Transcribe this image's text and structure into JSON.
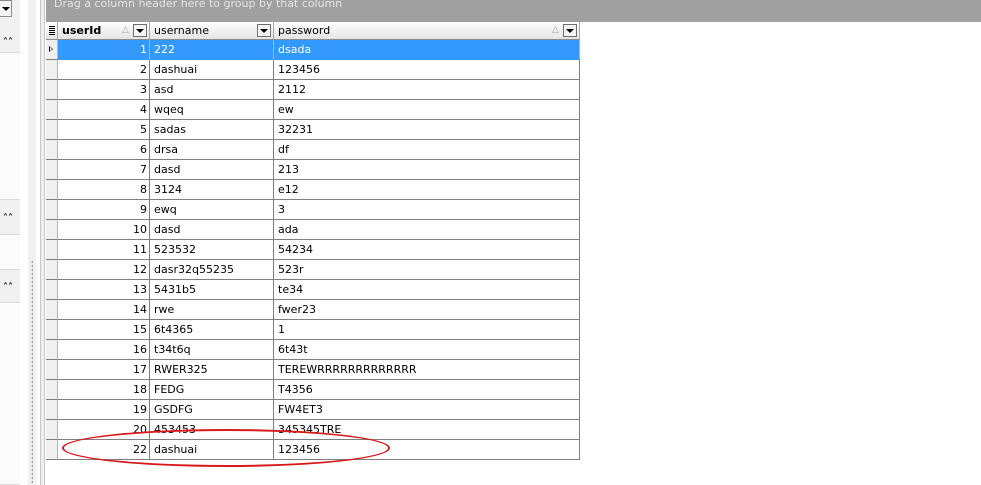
{
  "group_panel": {
    "hint": "Drag a column header here to group by that column"
  },
  "left_panel": {
    "collapse_glyph": "˄˄"
  },
  "grid": {
    "columns": [
      {
        "label": "userId",
        "sort_glyph": "△"
      },
      {
        "label": "username"
      },
      {
        "label": "password",
        "sort_glyph": "△"
      }
    ],
    "rows": [
      {
        "id": "1",
        "username": "222",
        "password": "dsada",
        "selected": true
      },
      {
        "id": "2",
        "username": "dashuai",
        "password": "123456"
      },
      {
        "id": "3",
        "username": "asd",
        "password": "2112"
      },
      {
        "id": "4",
        "username": "wqeq",
        "password": "ew"
      },
      {
        "id": "5",
        "username": "sadas",
        "password": "32231"
      },
      {
        "id": "6",
        "username": "drsa",
        "password": "df"
      },
      {
        "id": "7",
        "username": "dasd",
        "password": "213"
      },
      {
        "id": "8",
        "username": "3124",
        "password": "e12"
      },
      {
        "id": "9",
        "username": "ewq",
        "password": "3"
      },
      {
        "id": "10",
        "username": "dasd",
        "password": "ada"
      },
      {
        "id": "11",
        "username": "523532",
        "password": "54234"
      },
      {
        "id": "12",
        "username": "dasr32q55235",
        "password": "523r"
      },
      {
        "id": "13",
        "username": "5431b5",
        "password": "te34"
      },
      {
        "id": "14",
        "username": "rwe",
        "password": "fwer23"
      },
      {
        "id": "15",
        "username": "6t4365",
        "password": "1"
      },
      {
        "id": "16",
        "username": "t34t6q",
        "password": "6t43t"
      },
      {
        "id": "17",
        "username": "RWER325",
        "password": "TEREWRRRRRRRRRRRRR"
      },
      {
        "id": "18",
        "username": "FEDG",
        "password": "T4356"
      },
      {
        "id": "19",
        "username": "GSDFG",
        "password": "FW4ET3"
      },
      {
        "id": "20",
        "username": "453453",
        "password": "345345TRE"
      },
      {
        "id": "22",
        "username": "dashuai",
        "password": "123456"
      }
    ]
  },
  "colors": {
    "selection": "#3399ff",
    "annotation": "#d7191c",
    "group_panel": "#a0a0a0"
  }
}
